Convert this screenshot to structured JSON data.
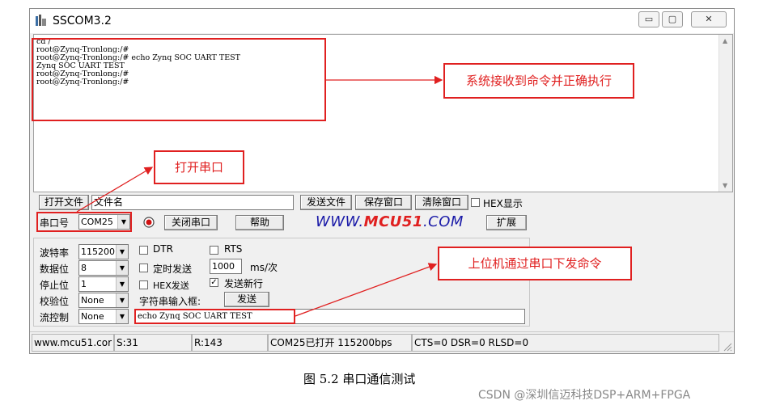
{
  "window": {
    "title": "SSCOM3.2",
    "min_label": "▭",
    "max_label": "▢",
    "close_label": "✕"
  },
  "terminal": {
    "lines": "cd /\nroot@Zynq-Tronlong:/#\nroot@Zynq-Tronlong:/# echo Zynq SOC UART TEST\nZynq SOC UART TEST\nroot@Zynq-Tronlong:/#\nroot@Zynq-Tronlong:/#"
  },
  "row1": {
    "open_file": "打开文件",
    "file_name": "文件名",
    "send_file": "发送文件",
    "save_window": "保存窗口",
    "clear_window": "清除窗口",
    "hex_display": "HEX显示"
  },
  "row2": {
    "port_label": "串口号",
    "port_value": "COM25",
    "close_port": "关闭串口",
    "help": "帮助",
    "expand": "扩展"
  },
  "brand": {
    "prefix": "WWW.",
    "mid": "MCU51",
    "suffix": ".COM"
  },
  "settings": {
    "baud_label": "波特率",
    "baud_value": "115200",
    "data_label": "数据位",
    "data_value": "8",
    "stop_label": "停止位",
    "stop_value": "1",
    "parity_label": "校验位",
    "parity_value": "None",
    "flow_label": "流控制",
    "flow_value": "None"
  },
  "options": {
    "dtr": "DTR",
    "rts": "RTS",
    "timed_send": "定时发送",
    "interval": "1000",
    "interval_unit": "ms/次",
    "hex_send": "HEX发送",
    "send_newline": "发送新行",
    "input_label": "字符串输入框:",
    "send": "发送",
    "input_value": "echo Zynq SOC UART TEST"
  },
  "status": {
    "site": "www.mcu51.cor",
    "sent": "S:31",
    "received": "R:143",
    "port_state": "COM25已打开  115200bps",
    "lines": "CTS=0 DSR=0 RLSD=0"
  },
  "annotations": {
    "received_ok": "系统接收到命令并正确执行",
    "open_port": "打开串口",
    "host_send": "上位机通过串口下发命令"
  },
  "caption": "图 5.2 串口通信测试",
  "watermark": "CSDN @深圳信迈科技DSP+ARM+FPGA",
  "colors": {
    "annotation": "#e02020",
    "brand_blue": "#1a1aa8"
  }
}
